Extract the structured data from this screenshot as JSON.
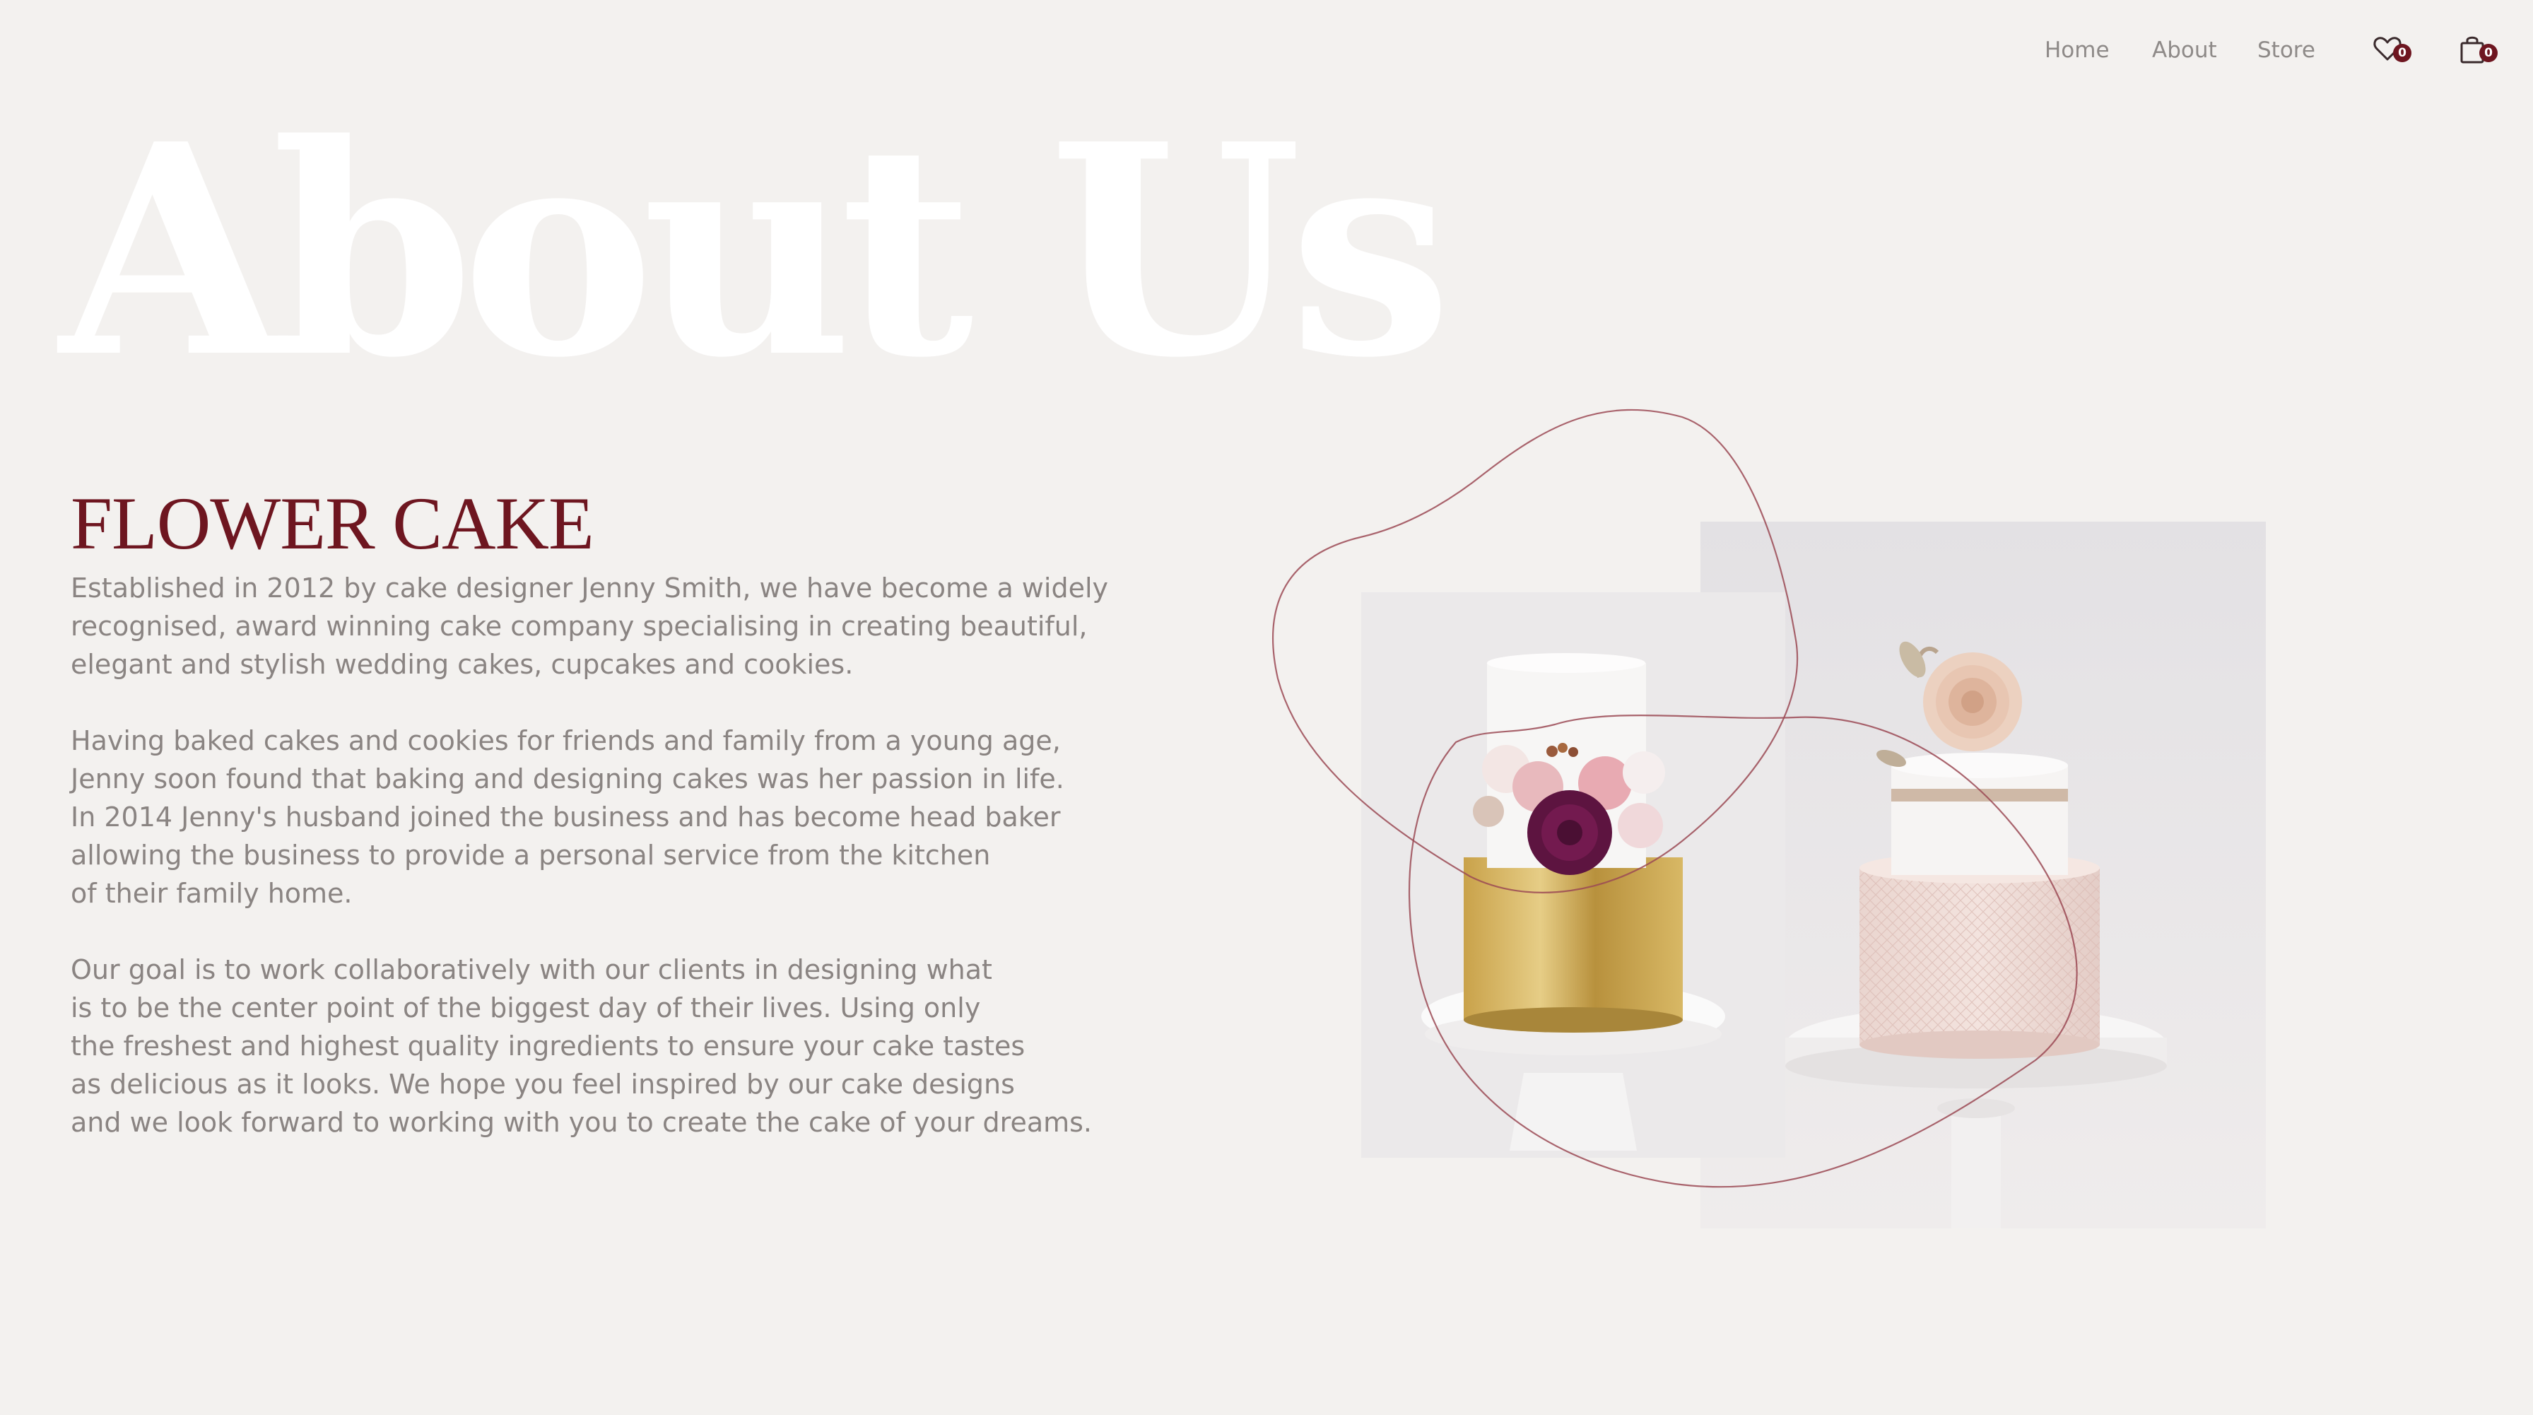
{
  "nav": {
    "links": [
      {
        "label": "Home"
      },
      {
        "label": "About"
      },
      {
        "label": "Store"
      }
    ],
    "wishlist": {
      "icon": "heart-icon",
      "count": "0"
    },
    "cart": {
      "icon": "shopping-bag-icon",
      "count": "0"
    }
  },
  "hero": {
    "title": "About Us"
  },
  "content": {
    "subtitle": "FLOWER CAKE",
    "paragraph1": [
      "Established in 2012 by cake designer Jenny Smith, we have become a widely",
      "recognised, award winning cake company specialising in creating beautiful,",
      "elegant and stylish wedding cakes, cupcakes and cookies."
    ],
    "paragraph2": [
      "Having baked cakes and cookies for friends and family from a young age,",
      "Jenny soon found that baking and designing cakes was her passion in life.",
      "In 2014 Jenny's husband joined the business and has become head baker",
      "allowing the business to provide a personal service from the kitchen",
      "of their family home."
    ],
    "paragraph3": [
      "Our goal is to work collaboratively with our clients in designing what",
      "is to be the center point of the biggest day of their lives. Using only",
      "the freshest and highest quality ingredients to ensure your cake tastes",
      "as delicious as it looks. We hope you feel inspired by our cake designs",
      "and we look forward to working with you to create the cake of your dreams."
    ]
  },
  "images": {
    "gold_cake": "gold-flower-cake-photo",
    "pink_cake": "pink-rose-cake-photo"
  },
  "colors": {
    "background": "#f3f1ef",
    "accent": "#6e1620",
    "nav_text": "#8e8a88",
    "body_text": "#8a8482",
    "hero_title": "#ffffff"
  }
}
